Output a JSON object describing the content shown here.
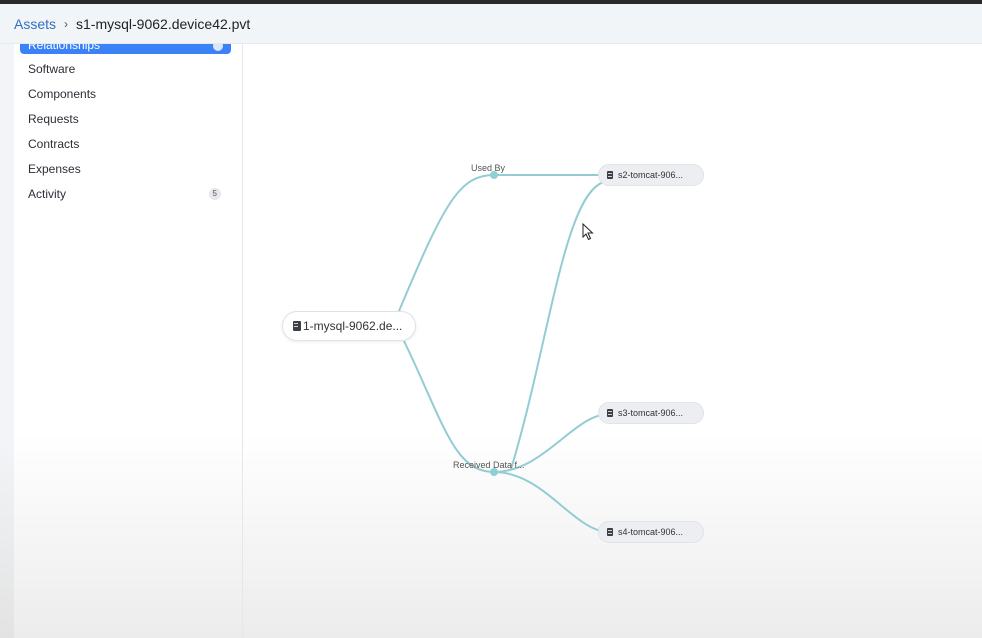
{
  "breadcrumb": {
    "root": "Assets",
    "separator": "›",
    "current": "s1-mysql-9062.device42.pvt"
  },
  "sidebar": {
    "active_item": "Relationships",
    "items": [
      {
        "label": "Software"
      },
      {
        "label": "Components"
      },
      {
        "label": "Requests"
      },
      {
        "label": "Contracts"
      },
      {
        "label": "Expenses"
      },
      {
        "label": "Activity",
        "badge": "5"
      }
    ]
  },
  "graph": {
    "center_node": "1-mysql-9062.de...",
    "edge_labels": {
      "used_by": "Used By",
      "received_data": "Received Data f..."
    },
    "nodes": {
      "n1": "s2-tomcat-906...",
      "n2": "s3-tomcat-906...",
      "n3": "s4-tomcat-906..."
    }
  },
  "colors": {
    "accent": "#3b82f6",
    "link": "#2f6fbf",
    "edge": "#93ccd3"
  },
  "icons": {
    "breadcrumb_separator": "chevron-right-icon",
    "node": "server-icon",
    "pointer": "mouse-cursor-icon"
  }
}
